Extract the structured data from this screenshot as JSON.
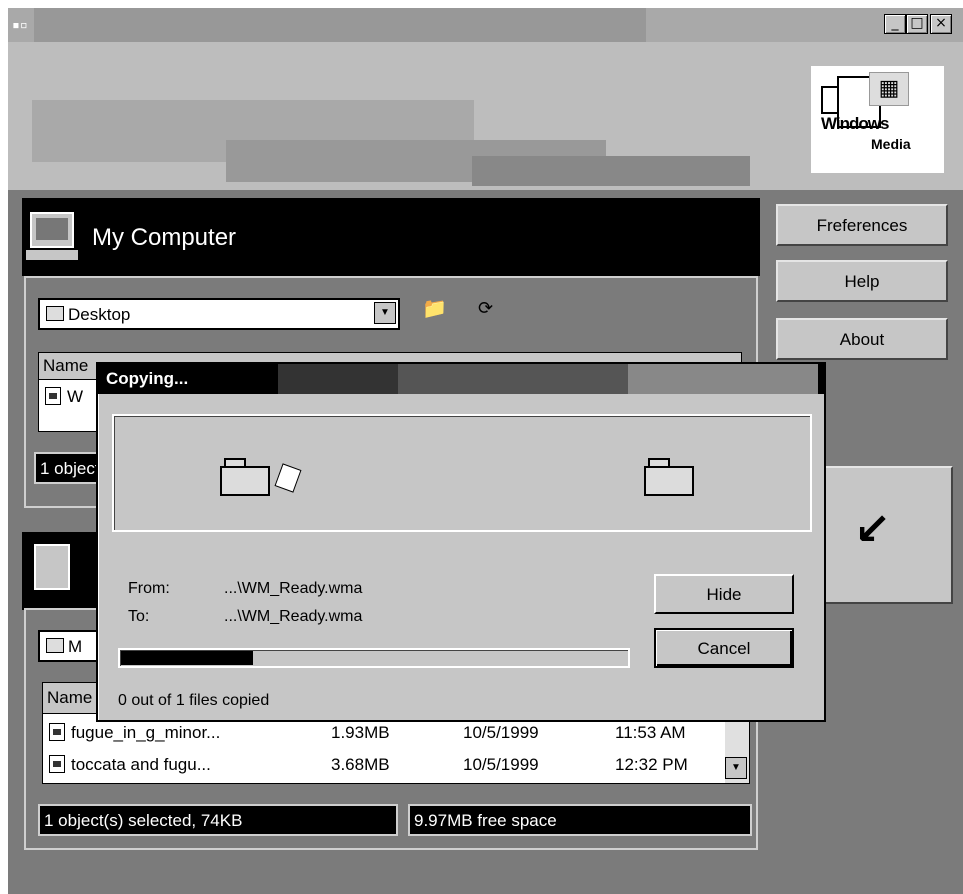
{
  "window": {
    "titlebar_buttons": [
      "_",
      "□",
      "×"
    ],
    "app_icon": "app-icon"
  },
  "logo": {
    "word1": "Windows",
    "word2": "Media"
  },
  "sidebar": {
    "preferences": "Freferences",
    "help": "Help",
    "about": "About",
    "transfer_arrow": "↙"
  },
  "top_panel": {
    "title": "My Computer",
    "folder": "Desktop",
    "header_col1": "Name",
    "row_prefix": "W",
    "status": "1 object(s) selected"
  },
  "bottom_panel": {
    "folder": "M",
    "header_col1": "Name",
    "files": [
      {
        "name": "fugue_in_g_minor...",
        "size": "1.93MB",
        "date": "10/5/1999",
        "time": "11:53 AM"
      },
      {
        "name": "toccata and fugu...",
        "size": "3.68MB",
        "date": "10/5/1999",
        "time": "12:32 PM"
      }
    ],
    "status_left": "1 object(s) selected, 74KB",
    "status_right": "9.97MB free space"
  },
  "dialog": {
    "title": "Copying...",
    "from_label": "From:",
    "from_value": "...\\WM_Ready.wma",
    "to_label": "To:",
    "to_value": "...\\WM_Ready.wma",
    "hide": "Hide",
    "cancel": "Cancel",
    "progress_fraction": 0.26,
    "status": "0 out of 1 files copied"
  }
}
